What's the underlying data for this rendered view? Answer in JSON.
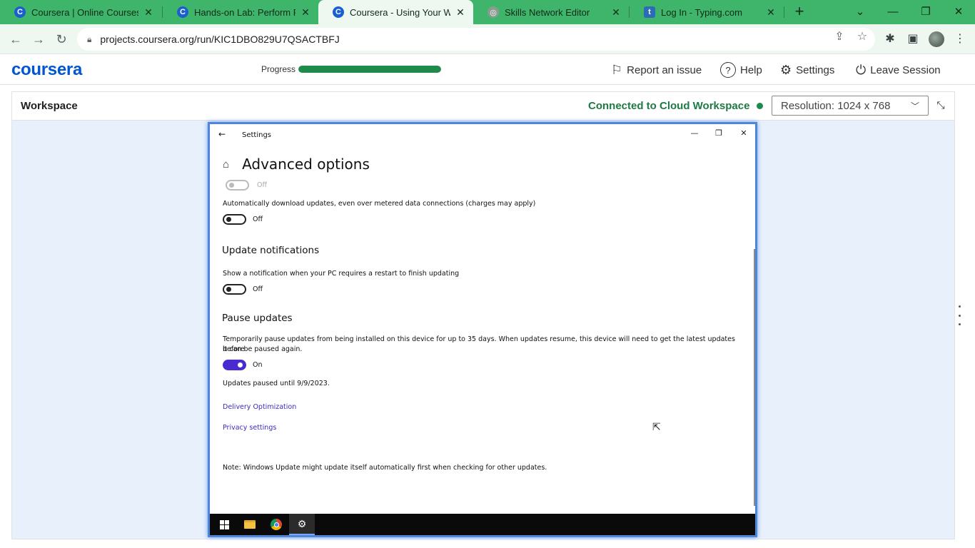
{
  "browser": {
    "tabs": [
      {
        "title": "Coursera | Online Courses &",
        "icon": "coursera-icon"
      },
      {
        "title": "Hands-on Lab: Perform Final",
        "icon": "coursera-icon"
      },
      {
        "title": "Coursera - Using Your Windo",
        "icon": "coursera-icon",
        "active": true
      },
      {
        "title": "Skills Network Editor",
        "icon": "globe-icon"
      },
      {
        "title": "Log In - Typing.com",
        "icon": "typing-icon"
      }
    ],
    "url": "projects.coursera.org/run/KIC1DBO829U7QSACTBFJ"
  },
  "coursera": {
    "logo": "coursera",
    "progress_label": "Progress",
    "progress_fraction": 1.0,
    "report_label": "Report an issue",
    "help_label": "Help",
    "settings_label": "Settings",
    "leave_label": "Leave Session"
  },
  "workspace": {
    "title": "Workspace",
    "status": "Connected to Cloud Workspace",
    "resolution": "Resolution:  1024 x 768"
  },
  "remote": {
    "window_title": "Settings",
    "page_title": "Advanced options",
    "top_toggle_state": "Off",
    "metered_text": "Automatically download updates, even over metered data connections (charges may apply)",
    "metered_state": "Off",
    "notif_heading": "Update notifications",
    "notif_text": "Show a notification when your PC requires a restart to finish updating",
    "notif_state": "Off",
    "pause_heading": "Pause updates",
    "pause_text_1": "Temporarily pause updates from being installed on this device for up to 35 days. When updates resume, this device will need to get the latest updates before",
    "pause_text_2": "it can be paused again.",
    "pause_state": "On",
    "paused_until": "Updates paused until 9/9/2023.",
    "link_delivery": "Delivery Optimization",
    "link_privacy": "Privacy settings",
    "note": "Note: Windows Update might update itself automatically first when checking for other updates."
  },
  "colors": {
    "tabbar": "#3fb56b",
    "coursera_blue": "#0056d2",
    "connected_green": "#1e7a45",
    "toggle_on": "#4a2bd0"
  }
}
